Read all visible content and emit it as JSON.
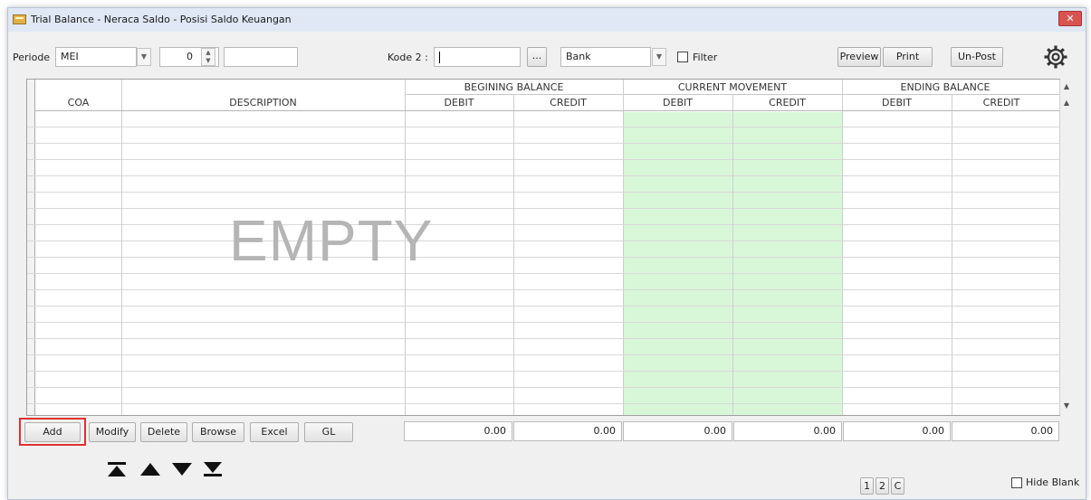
{
  "window": {
    "title": "Trial Balance - Neraca Saldo - Posisi Saldo Keuangan",
    "close_label": "✕"
  },
  "toolbar": {
    "periode_label": "Periode",
    "periode_value": "MEI",
    "year_value": "0",
    "extra_value": "",
    "kode_label": "Kode 2 :",
    "kode_value": "",
    "browse_label": "...",
    "bank_value": "Bank",
    "filter_label": "Filter",
    "preview_label": "Preview",
    "print_label": "Print",
    "unpost_label": "Un-Post",
    "settings_icon": "gear-icon"
  },
  "grid": {
    "group_headers": [
      "BEGINING BALANCE",
      "CURRENT MOVEMENT",
      "ENDING BALANCE"
    ],
    "columns": [
      "COA",
      "DESCRIPTION",
      "DEBIT",
      "CREDIT",
      "DEBIT",
      "CREDIT",
      "DEBIT",
      "CREDIT"
    ],
    "empty_text": "EMPTY",
    "highlight_color": "#d8f7d8"
  },
  "actions": {
    "add": "Add",
    "modify": "Modify",
    "delete": "Delete",
    "browse": "Browse",
    "excel": "Excel",
    "gl": "GL"
  },
  "totals": [
    "0.00",
    "0.00",
    "0.00",
    "0.00",
    "0.00",
    "0.00"
  ],
  "pager": [
    "1",
    "2",
    "C"
  ],
  "hide_blank_label": "Hide Blank",
  "nav_icons": [
    "first-icon",
    "prev-icon",
    "next-icon",
    "last-icon"
  ]
}
